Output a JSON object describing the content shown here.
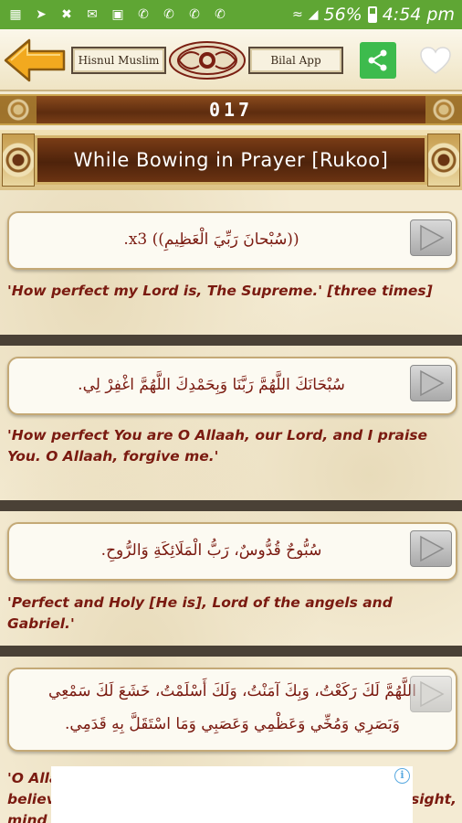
{
  "status_bar": {
    "battery": "56%",
    "time": "4:54 pm",
    "left_icons": [
      "message-icon",
      "navigation-icon",
      "missed-call-icon",
      "mail-icon",
      "gallery-icon",
      "whatsapp-icon",
      "whatsapp-icon",
      "whatsapp-icon",
      "whatsapp-icon"
    ],
    "right_icons": [
      "wifi-icon",
      "signal-icon"
    ]
  },
  "header": {
    "left_title": "Hisnul Muslim",
    "right_title": "Bilal App",
    "back_icon": "back-arrow-icon",
    "share_icon": "share-icon",
    "favorite_icon": "heart-icon"
  },
  "chapter": {
    "number": "017",
    "title": "While Bowing in Prayer [Rukoo]"
  },
  "duas": [
    {
      "arabic": "((سُبْحانَ رَبِّيَ الْعَظِيمِ)) x3.",
      "translation": "'How perfect my Lord is, The Supreme.' [three times]"
    },
    {
      "arabic": "سُبْحَانَكَ اللَّهُمَّ رَبَّنَا وَبِحَمْدِكَ اللَّهُمَّ اغْفِرْ لِي.",
      "translation": "'How perfect You are O Allaah, our Lord, and I praise You. O Allaah, forgive me.'"
    },
    {
      "arabic": "سُبُّوحٌ قُدُّوسٌ، رَبُّ الْمَلَائِكَةِ وَالرُّوحِ.",
      "translation": "'Perfect and Holy [He is], Lord of the angels and Gabriel.'"
    },
    {
      "arabic_line1": "اللَّهُمَّ لَكَ رَكَعْتُ، وَبِكَ آمَنْتُ، وَلَكَ أَسْلَمْتُ، خَشَعَ لَكَ سَمْعِي",
      "arabic_line2": "وَبَصَرِي وَمُخِّي وَعَظْمِي وَعَصَبِي وَمَا اسْتَقَلَّ بِهِ قَدَمِي.",
      "translation_line1_left": "'O Alla",
      "translation_line2_left": "believ",
      "translation_line2_right": "sight,",
      "translation_line3_left": "mind"
    }
  ],
  "colors": {
    "status_bar": "#5fa634",
    "share_button": "#3dbb4d",
    "text_maroon": "#7a1a10",
    "divider": "#4a4136"
  },
  "ad": {
    "info_icon": "i"
  }
}
